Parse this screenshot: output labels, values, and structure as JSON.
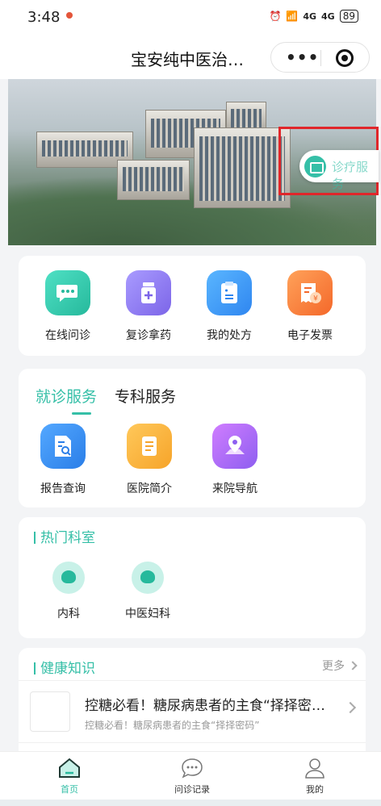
{
  "status_bar": {
    "time": "3:48",
    "signal_1": "4G",
    "signal_2": "4G",
    "battery": "89"
  },
  "nav": {
    "title": "宝安纯中医治…",
    "more_label": "•••"
  },
  "banner": {
    "float_button_label": "诊疗服务"
  },
  "quick_actions": [
    {
      "label": "在线问诊",
      "icon": "chat-bubble-icon"
    },
    {
      "label": "复诊拿药",
      "icon": "medicine-bottle-icon"
    },
    {
      "label": "我的处方",
      "icon": "clipboard-icon"
    },
    {
      "label": "电子发票",
      "icon": "invoice-icon"
    }
  ],
  "services": {
    "tabs": [
      "就诊服务",
      "专科服务"
    ],
    "active_tab": 0,
    "items": [
      {
        "label": "报告查询",
        "icon": "report-search-icon"
      },
      {
        "label": "医院简介",
        "icon": "document-icon"
      },
      {
        "label": "来院导航",
        "icon": "location-pin-icon"
      }
    ]
  },
  "departments": {
    "title": "热门科室",
    "items": [
      {
        "label": "内科",
        "icon": "brain-icon"
      },
      {
        "label": "中医妇科",
        "icon": "brain-icon"
      }
    ]
  },
  "health": {
    "title": "健康知识",
    "more_label": "更多",
    "articles": [
      {
        "title": "控糖必看！糖尿病患者的主食“择择密码”",
        "subtitle": "控糖必看！糖尿病患者的主食“择择密码”"
      }
    ]
  },
  "tab_bar": {
    "items": [
      {
        "label": "首页",
        "active": true
      },
      {
        "label": "问诊记录",
        "active": false
      },
      {
        "label": "我的",
        "active": false
      }
    ]
  },
  "colors": {
    "accent": "#35bfa7",
    "highlight_box": "#e0262a"
  }
}
